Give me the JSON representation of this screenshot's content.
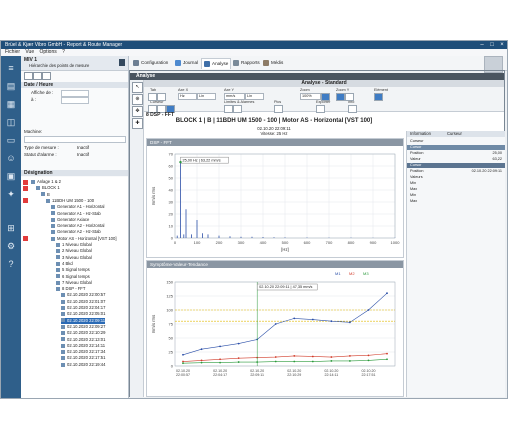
{
  "window": {
    "title": "Brüel & Kjær Vibro GmbH - Report & Route Manager"
  },
  "menu": [
    "Fichier",
    "Vue",
    "Options",
    "?"
  ],
  "nav": {
    "header": "MIV 1",
    "subheader": "Hiérarchie des points de mesure",
    "date_section": "Date / Heure",
    "display_label": "Affiche de :",
    "display_value": "",
    "to_label": "à :",
    "machine_label": "Machine:",
    "measure_type_label": "Type de mesure :",
    "measure_type_value": "Inactif",
    "alarm_status_label": "Statut d'alarme :",
    "alarm_status_value": "Inactif",
    "designation_label": "Désignation",
    "tree": [
      {
        "label": "Anlage 1 & 2",
        "level": 0,
        "mark": true
      },
      {
        "label": "BLOCK 1",
        "level": 1,
        "mark": true
      },
      {
        "label": "B",
        "level": 2,
        "mark": false
      },
      {
        "label": "11BDH UM 1500 - 100",
        "level": 3,
        "mark": true
      },
      {
        "label": "Generator A1 - Horizontal",
        "level": 4,
        "mark": false
      },
      {
        "label": "Generator A1 - Hz-Stab",
        "level": 4,
        "mark": false
      },
      {
        "label": "Generator Axiace",
        "level": 4,
        "mark": false
      },
      {
        "label": "Generator A2 - Horizontal",
        "level": 4,
        "mark": false
      },
      {
        "label": "Generator A2 - Hz-Stab",
        "level": 4,
        "mark": false
      },
      {
        "label": "Motor AS - Horizontal [VST 100]",
        "level": 4,
        "mark": true
      },
      {
        "label": "1 Niveau Global",
        "level": 5,
        "mark": false
      },
      {
        "label": "2 Niveau Global",
        "level": 5,
        "mark": false
      },
      {
        "label": "3 Niveau Global",
        "level": 5,
        "mark": false
      },
      {
        "label": "4 Bkd",
        "level": 5,
        "mark": false
      },
      {
        "label": "5 Signal temps",
        "level": 5,
        "mark": false
      },
      {
        "label": "6 Signal temps",
        "level": 5,
        "mark": false
      },
      {
        "label": "7 Niveau Global",
        "level": 5,
        "mark": false
      },
      {
        "label": "8 DSP - FFT",
        "level": 5,
        "mark": false
      },
      {
        "label": "02.10.2020 22:00:57",
        "level": 6,
        "mark": false
      },
      {
        "label": "02.10.2020 22:01:07",
        "level": 6,
        "mark": false
      },
      {
        "label": "02.10.2020 22:04:17",
        "level": 6,
        "mark": false
      },
      {
        "label": "02.10.2020 22:05:01",
        "level": 6,
        "mark": false
      },
      {
        "label": "02.10.2020 22:09:11",
        "level": 6,
        "mark": false,
        "selected": true
      },
      {
        "label": "02.10.2020 22:09:27",
        "level": 6,
        "mark": false
      },
      {
        "label": "02.10.2020 22:10:29",
        "level": 6,
        "mark": false
      },
      {
        "label": "02.10.2020 22:13:01",
        "level": 6,
        "mark": false
      },
      {
        "label": "02.10.2020 22:14:11",
        "level": 6,
        "mark": false
      },
      {
        "label": "02.10.2020 22:17:34",
        "level": 6,
        "mark": false
      },
      {
        "label": "02.10.2020 22:17:51",
        "level": 6,
        "mark": false
      },
      {
        "label": "02.10.2020 22:19:44",
        "level": 6,
        "mark": false
      }
    ]
  },
  "tabs": [
    {
      "label": "Configuration",
      "color": "#6d7f93"
    },
    {
      "label": "Journal",
      "color": "#4e8ad0"
    },
    {
      "label": "Analyse",
      "color": "#3f6fa8"
    },
    {
      "label": "Rapports",
      "color": "#7a8a99"
    },
    {
      "label": "Médis",
      "color": "#8d7b66"
    }
  ],
  "analyse": {
    "bar_title": "Analyse",
    "panel_title": "Analyse - Standard",
    "ribbon": {
      "groups": [
        "Tab",
        "Axe X",
        "Axe Y",
        "Zoom",
        "Zoom Y",
        "Elément",
        "Curseur",
        "Limites & Alarmes",
        "Pics",
        "Exporter",
        "Info"
      ],
      "x_unit": "Hz",
      "x_scale": "Lin",
      "y_unit": "mm/s",
      "y_scale": "Lin",
      "zoom_value": "100%"
    },
    "section_label": "8 DSP - FFT",
    "main_title": "BLOCK 1 | B | 11BDH UM 1500 - 100 | Motor AS - Horizontal [VST 100]",
    "main_date": "02.10.20 22:09:11",
    "main_speed": "Vitesse: 25 Hz"
  },
  "spectrum": {
    "header": "DSP - FFT",
    "cursor_label": "25,00 Hz | 63,22 mm/s"
  },
  "trend": {
    "header": "Symptôme-Valeur-Tendance",
    "cursor_label": "02.10.20 22:09:11 | 47,35 mm/s",
    "legend": [
      "M1",
      "M2",
      "M3"
    ]
  },
  "right_panel": {
    "tabs": [
      "Information",
      "Curseur"
    ],
    "rows": [
      {
        "label": "Curseur",
        "value": "",
        "style": ""
      },
      {
        "label": "Cursor",
        "value": "",
        "style": "hl"
      },
      {
        "label": "Position",
        "value": "25,00",
        "style": ""
      },
      {
        "label": "Valeur",
        "value": "63,22",
        "style": ""
      },
      {
        "label": "Cursor",
        "value": "",
        "style": "hl2"
      },
      {
        "label": "Position",
        "value": "02.10.20 22:09:11",
        "style": ""
      },
      {
        "label": "Valeurs",
        "value": "",
        "style": ""
      },
      {
        "label": "Min",
        "value": "",
        "style": ""
      },
      {
        "label": "Max",
        "value": "",
        "style": ""
      },
      {
        "label": "Min",
        "value": "",
        "style": ""
      },
      {
        "label": "Max",
        "value": "",
        "style": ""
      }
    ]
  },
  "chart_data": [
    {
      "type": "line",
      "title": "DSP - FFT",
      "xlabel": "[Hz]",
      "ylabel": "mm/s rms",
      "xlim": [
        0,
        1000
      ],
      "ylim": [
        0,
        70
      ],
      "xticks": [
        0,
        100,
        200,
        300,
        400,
        500,
        600,
        700,
        800,
        900,
        1000
      ],
      "yticks": [
        0,
        10,
        20,
        30,
        40,
        50,
        60,
        70
      ],
      "series": [
        {
          "x": [
            0,
            10,
            25,
            40,
            50,
            75,
            100,
            125,
            150,
            200,
            250,
            300,
            350,
            400,
            450,
            500,
            600,
            700,
            800,
            900,
            1000
          ],
          "y": [
            0,
            2,
            63.22,
            3,
            24,
            3,
            15,
            4,
            3,
            2,
            1.5,
            1,
            1,
            0.8,
            0.6,
            0.5,
            0.4,
            0.3,
            0.3,
            0.2,
            0.2
          ]
        }
      ],
      "grid": true
    },
    {
      "type": "line",
      "title": "Symptôme-Valeur-Tendance",
      "ylabel": "mm/s rms",
      "ylim": [
        0,
        150
      ],
      "yticks": [
        0,
        25,
        50,
        75,
        100,
        125,
        150
      ],
      "categories": [
        "02.10.20 22:00:57",
        "02.10.20 22:01:07",
        "02.10.20 22:04:17",
        "02.10.20 22:05:01",
        "02.10.20 22:09:11",
        "02.10.20 22:09:27",
        "02.10.20 22:10:29",
        "02.10.20 22:13:01",
        "02.10.20 22:14:11",
        "02.10.20 22:17:34",
        "02.10.20 22:17:51",
        "02.10.20 22:19:44"
      ],
      "series": [
        {
          "name": "M1",
          "color": "#2b4fa8",
          "values": [
            20,
            30,
            35,
            40,
            47.35,
            75,
            85,
            83,
            80,
            78,
            100,
            130
          ]
        },
        {
          "name": "M2",
          "color": "#d13b2a",
          "values": [
            8,
            10,
            12,
            14,
            15,
            16,
            18,
            17,
            16,
            18,
            19,
            22
          ]
        },
        {
          "name": "M3",
          "color": "#2b9a3c",
          "values": [
            5,
            6,
            6,
            7,
            7,
            8,
            8,
            8,
            9,
            9,
            10,
            12
          ]
        }
      ],
      "thresholds": [
        {
          "value": 80,
          "color": "#e0b800"
        },
        {
          "value": 100,
          "color": "#e0b800"
        }
      ],
      "grid": true
    }
  ]
}
